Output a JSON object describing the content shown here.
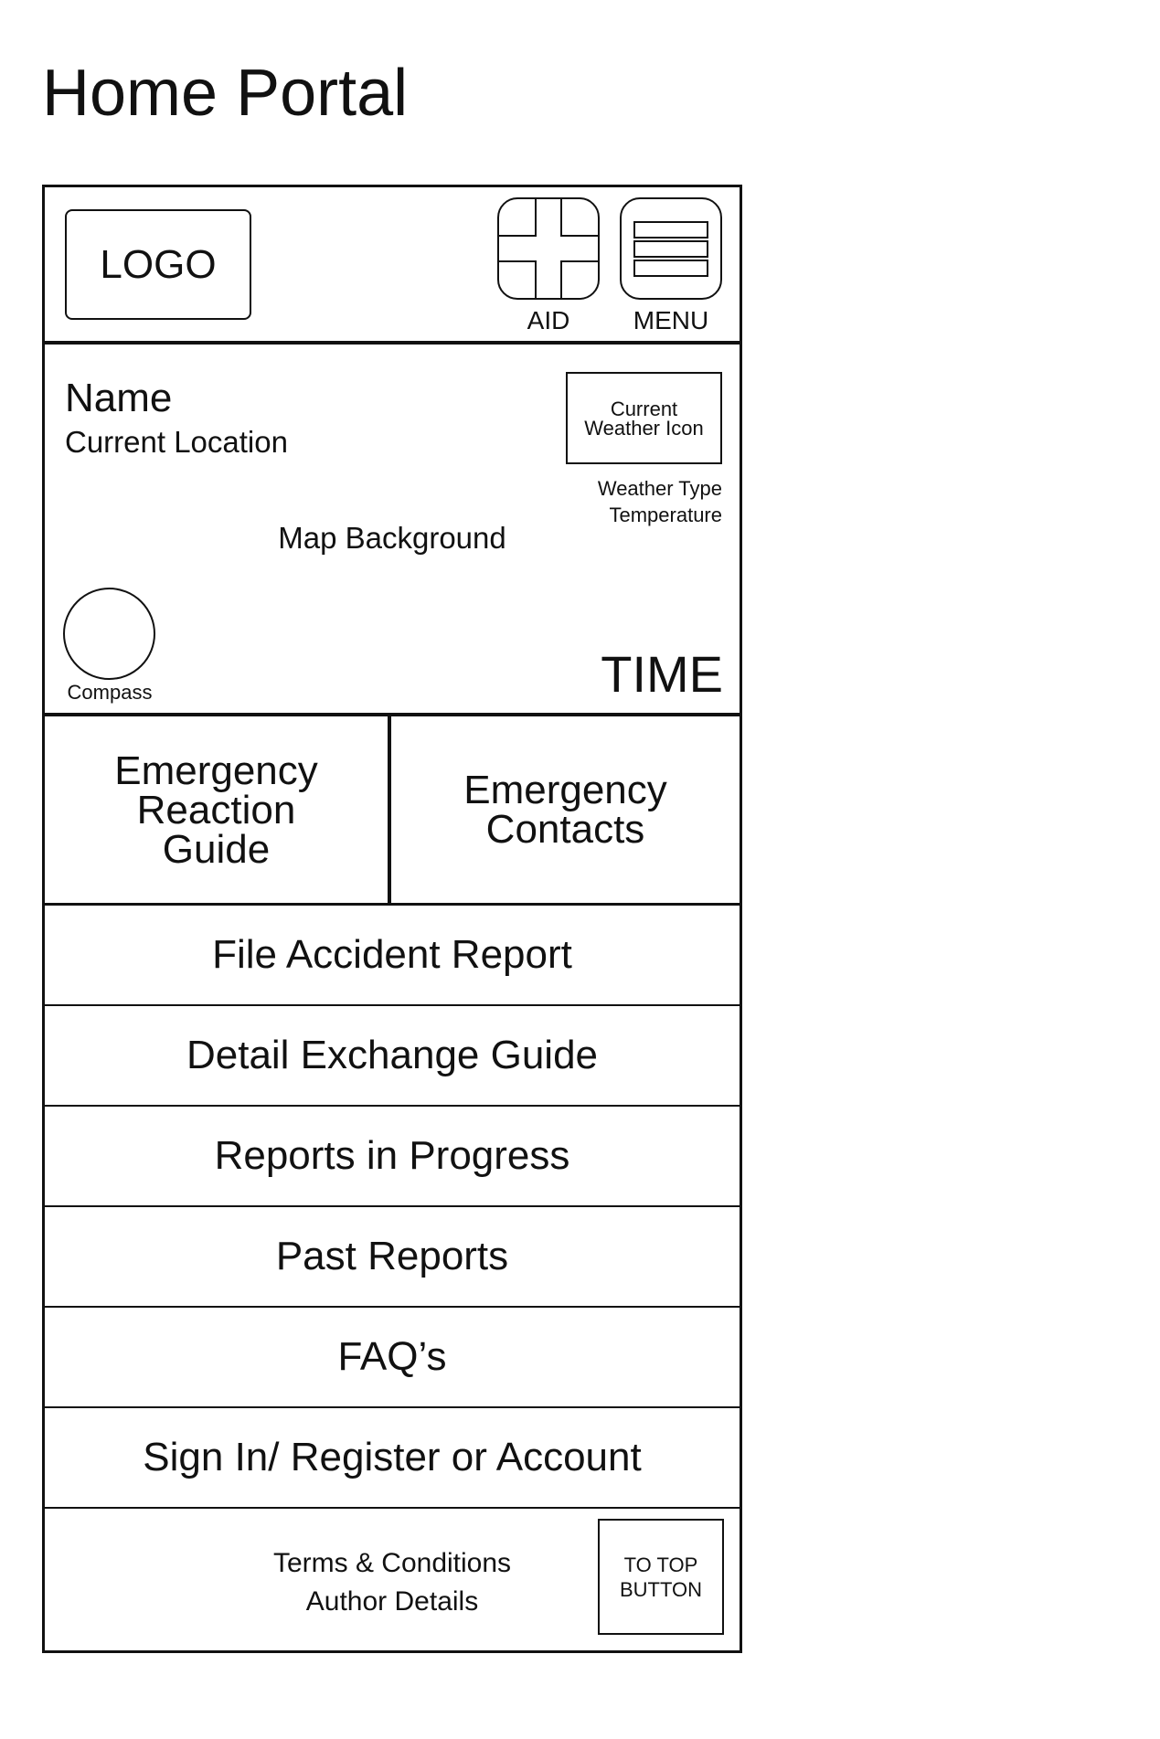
{
  "page_title": "Home Portal",
  "header": {
    "logo_text": "LOGO",
    "aid_icon": "cross-icon",
    "aid_label": "AID",
    "menu_icon": "hamburger-icon",
    "menu_label": "MENU"
  },
  "map_panel": {
    "user_name": "Name",
    "current_location": "Current Location",
    "weather_icon_placeholder": "Current Weather Icon",
    "weather_type": "Weather Type",
    "temperature": "Temperature",
    "background_label": "Map Background",
    "compass_label": "Compass",
    "time": "TIME"
  },
  "quick_actions": [
    {
      "label": "Emergency Reaction Guide"
    },
    {
      "label": "Emergency Contacts"
    }
  ],
  "menu_items": [
    {
      "label": "File Accident Report"
    },
    {
      "label": "Detail Exchange Guide"
    },
    {
      "label": "Reports in Progress"
    },
    {
      "label": "Past Reports"
    },
    {
      "label": "FAQ’s"
    },
    {
      "label": "Sign In/ Register or Account"
    }
  ],
  "footer": {
    "terms": "Terms & Conditions",
    "author": "Author Details",
    "to_top": "TO TOP BUTTON"
  }
}
